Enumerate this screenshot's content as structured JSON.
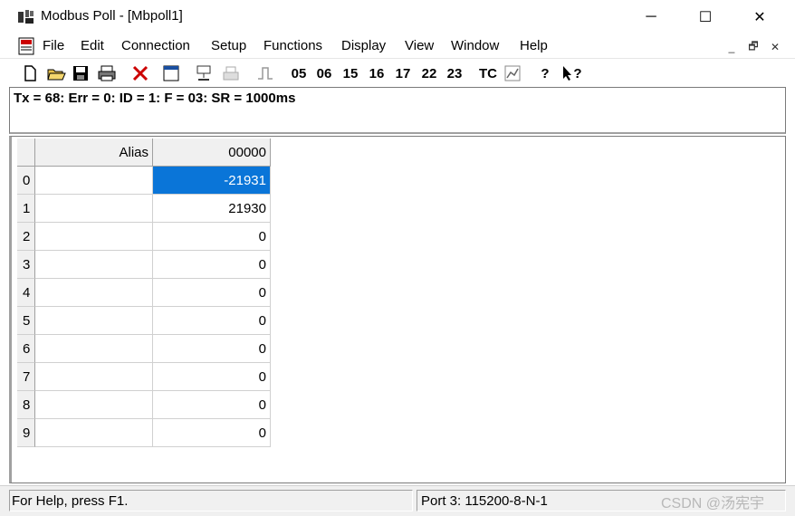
{
  "window": {
    "title": "Modbus Poll - [Mbpoll1]",
    "minimize": "─",
    "maximize": "☐",
    "close": "✕"
  },
  "menu": {
    "items": [
      "File",
      "Edit",
      "Connection",
      "Setup",
      "Functions",
      "Display",
      "View",
      "Window",
      "Help"
    ],
    "mdi_min": "_",
    "mdi_restore": "🗗",
    "mdi_close": "✕"
  },
  "toolbar": {
    "func_05": "05",
    "func_06": "06",
    "func_15": "15",
    "func_16": "16",
    "func_17": "17",
    "func_22": "22",
    "func_23": "23",
    "tc": "TC",
    "help_glyph": "?",
    "whatsthis_glyph": "?"
  },
  "status_line": {
    "text": "Tx = 68: Err = 0: ID = 1: F = 03: SR = 1000ms"
  },
  "grid": {
    "alias_header": "Alias",
    "address_header": "00000",
    "rows": [
      {
        "index": "0",
        "alias": "",
        "value": "-21931"
      },
      {
        "index": "1",
        "alias": "",
        "value": "21930"
      },
      {
        "index": "2",
        "alias": "",
        "value": "0"
      },
      {
        "index": "3",
        "alias": "",
        "value": "0"
      },
      {
        "index": "4",
        "alias": "",
        "value": "0"
      },
      {
        "index": "5",
        "alias": "",
        "value": "0"
      },
      {
        "index": "6",
        "alias": "",
        "value": "0"
      },
      {
        "index": "7",
        "alias": "",
        "value": "0"
      },
      {
        "index": "8",
        "alias": "",
        "value": "0"
      },
      {
        "index": "9",
        "alias": "",
        "value": "0"
      }
    ]
  },
  "statusbar": {
    "help": "For Help, press F1.",
    "port": "Port 3: 115200-8-N-1"
  },
  "watermark": "CSDN @汤宪宇"
}
